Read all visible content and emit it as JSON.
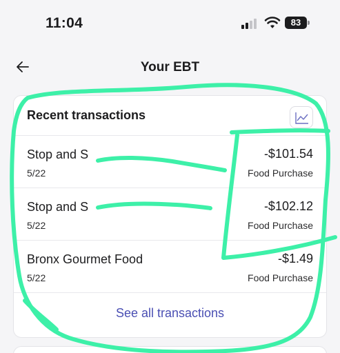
{
  "status_bar": {
    "time": "11:04",
    "battery": "83"
  },
  "header": {
    "title": "Your EBT",
    "back_icon": "arrow-left-icon"
  },
  "recent": {
    "title": "Recent transactions",
    "chart_icon": "line-chart-icon",
    "transactions": [
      {
        "merchant": "Stop and S",
        "date": "5/22",
        "amount": "-$101.54",
        "type": "Food Purchase"
      },
      {
        "merchant": "Stop and S",
        "date": "5/22",
        "amount": "-$102.12",
        "type": "Food Purchase"
      },
      {
        "merchant": "Bronx Gourmet Food",
        "date": "5/22",
        "amount": "-$1.49",
        "type": "Food Purchase"
      }
    ],
    "see_all_label": "See all transactions"
  },
  "colors": {
    "accent": "#4a4fb3",
    "marker": "#3df0a8",
    "background": "#f5f5f7"
  }
}
